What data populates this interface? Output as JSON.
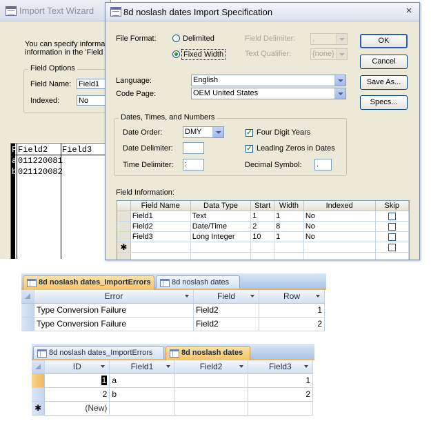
{
  "wizard": {
    "title": "Import Text Wizard",
    "intro_line1": "You can specify informat",
    "intro_line2": "information in the 'Field (",
    "field_options_label": "Field Options",
    "field_name_label": "Field Name:",
    "field_name_value": "Field1",
    "indexed_label": "Indexed:",
    "indexed_value": "No",
    "preview": {
      "header_col0": "F",
      "header_col1": "Field2",
      "header_col2": "Field3",
      "rows": [
        {
          "c0": "a",
          "rest": "011220081"
        },
        {
          "c0": "b",
          "rest": "021120082"
        }
      ]
    }
  },
  "dialog": {
    "title": "8d noslash dates Import Specification",
    "close_glyph": "×",
    "file_format_label": "File Format:",
    "delimited_label": "Delimited",
    "fixed_width_label": "Fixed Width",
    "field_delimiter_label": "Field Delimiter:",
    "field_delimiter_value": ",",
    "text_qualifier_label": "Text Qualifier:",
    "text_qualifier_value": "{none}",
    "ok_label": "OK",
    "cancel_label": "Cancel",
    "save_as_label": "Save As...",
    "specs_label": "Specs...",
    "language_label": "Language:",
    "language_value": "English",
    "code_page_label": "Code Page:",
    "code_page_value": "OEM United States",
    "dtn_group_label": "Dates, Times, and Numbers",
    "date_order_label": "Date Order:",
    "date_order_value": "DMY",
    "four_digit_years_label": "Four Digit Years",
    "four_digit_years_checked": true,
    "date_delimiter_label": "Date Delimiter:",
    "date_delimiter_value": "",
    "leading_zeros_label": "Leading Zeros in Dates",
    "leading_zeros_checked": true,
    "time_delimiter_label": "Time Delimiter:",
    "time_delimiter_value": ":",
    "decimal_symbol_label": "Decimal Symbol:",
    "decimal_symbol_value": ".",
    "field_info_label": "Field Information:",
    "check_glyph": "✓",
    "new_row_glyph": "✱",
    "field_grid": {
      "headers": [
        "Field Name",
        "Data Type",
        "Start",
        "Width",
        "Indexed",
        "Skip"
      ],
      "rows": [
        [
          "Field1",
          "Text",
          "1",
          "1",
          "No"
        ],
        [
          "Field2",
          "Date/Time",
          "2",
          "8",
          "No"
        ],
        [
          "Field3",
          "Long Integer",
          "10",
          "1",
          "No"
        ]
      ]
    }
  },
  "errors_table": {
    "tab1": "8d noslash dates_ImportErrors",
    "tab2": "8d noslash dates",
    "headers": [
      "Error",
      "Field",
      "Row"
    ],
    "rows": [
      [
        "Type Conversion Failure",
        "Field2",
        "1"
      ],
      [
        "Type Conversion Failure",
        "Field2",
        "2"
      ]
    ]
  },
  "dates_table": {
    "tab1": "8d noslash dates_ImportErrors",
    "tab2": "8d noslash dates",
    "headers": [
      "ID",
      "Field1",
      "Field2",
      "Field3"
    ],
    "rows": [
      [
        "1",
        "a",
        "",
        "1"
      ],
      [
        "2",
        "b",
        "",
        "2"
      ]
    ],
    "new_label": "(New)",
    "new_row_glyph": "✱"
  }
}
